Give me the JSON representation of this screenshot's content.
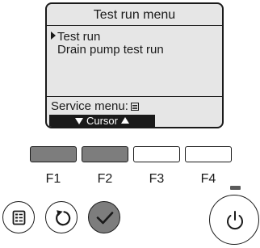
{
  "screen": {
    "title": "Test run menu",
    "items": [
      {
        "label": "Test run",
        "selected": true
      },
      {
        "label": "Drain pump test run",
        "selected": false
      }
    ],
    "service_menu_label": "Service menu:",
    "cursor_label": "Cursor"
  },
  "function_keys": [
    {
      "label": "F1",
      "state": "active"
    },
    {
      "label": "F2",
      "state": "active"
    },
    {
      "label": "F3",
      "state": "inactive"
    },
    {
      "label": "F4",
      "state": "inactive"
    }
  ],
  "buttons": {
    "menu": "menu-icon",
    "return": "return-icon",
    "confirm": "checkmark-icon",
    "power": "power-icon"
  },
  "colors": {
    "screen_background": "#e6e6e6",
    "active_key": "#7d7d7d",
    "ink": "#1a1a1a"
  }
}
